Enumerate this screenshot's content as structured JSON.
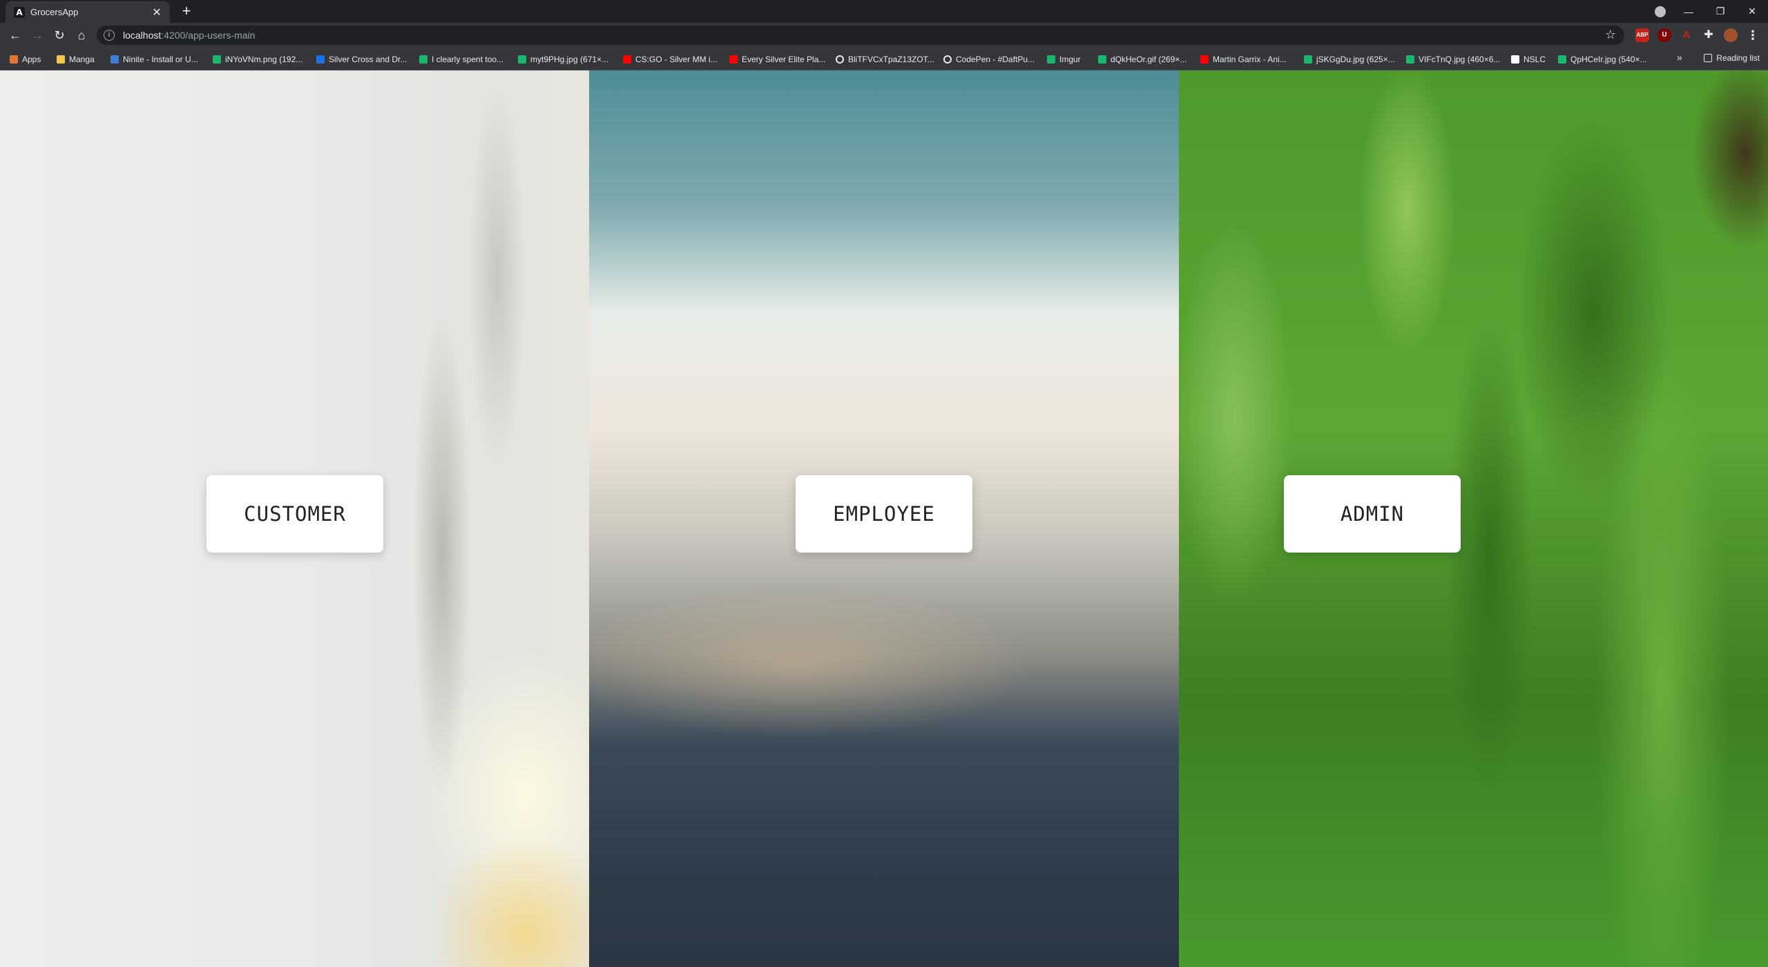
{
  "browser": {
    "tab_title": "GrocersApp",
    "url_host": "localhost",
    "url_path": ":4200/app-users-main",
    "bookmarks": [
      {
        "label": "Apps",
        "icon": "apps-grid-icon",
        "color": "#e2743a"
      },
      {
        "label": "Manga",
        "icon": "folder-icon",
        "color": "#f2c94c"
      },
      {
        "label": "Ninite - Install or U...",
        "icon": "ninite-icon",
        "color": "#3f7dd8"
      },
      {
        "label": "iNYoVNm.png (192...",
        "icon": "imgur-icon",
        "color": "#1bb76e"
      },
      {
        "label": "Silver Cross and Dr...",
        "icon": "square-icon",
        "color": "#1a73e8"
      },
      {
        "label": "I clearly spent too...",
        "icon": "imgur-icon",
        "color": "#1bb76e"
      },
      {
        "label": "myt9PHg.jpg (671×...",
        "icon": "imgur-icon",
        "color": "#1bb76e"
      },
      {
        "label": "CS:GO - Silver MM i...",
        "icon": "youtube-icon",
        "color": "#ff0000"
      },
      {
        "label": "Every Silver Elite Pla...",
        "icon": "youtube-icon",
        "color": "#ff0000"
      },
      {
        "label": "BliTFVCxTpaZ13ZOT...",
        "icon": "globe-icon",
        "color": "#e8eaed"
      },
      {
        "label": "CodePen - #DaftPu...",
        "icon": "codepen-icon",
        "color": "#e8eaed"
      },
      {
        "label": "Imgur",
        "icon": "imgur-icon",
        "color": "#1bb76e"
      },
      {
        "label": "dQkHeOr.gif (269×...",
        "icon": "imgur-icon",
        "color": "#1bb76e"
      },
      {
        "label": "Martin Garrix - Ani...",
        "icon": "youtube-icon",
        "color": "#ff0000"
      },
      {
        "label": "jSKGgDu.jpg (625×...",
        "icon": "imgur-icon",
        "color": "#1bb76e"
      },
      {
        "label": "VIFcTnQ.jpg (460×6...",
        "icon": "imgur-icon",
        "color": "#1bb76e"
      },
      {
        "label": "NSLC",
        "icon": "page-icon",
        "color": "#ffffff"
      },
      {
        "label": "QpHCeIr.jpg (540×...",
        "icon": "imgur-icon",
        "color": "#1bb76e"
      }
    ],
    "more_bookmarks": "»",
    "reading_list": "Reading list"
  },
  "roles": {
    "customer": "CUSTOMER",
    "employee": "EMPLOYEE",
    "admin": "ADMIN"
  }
}
